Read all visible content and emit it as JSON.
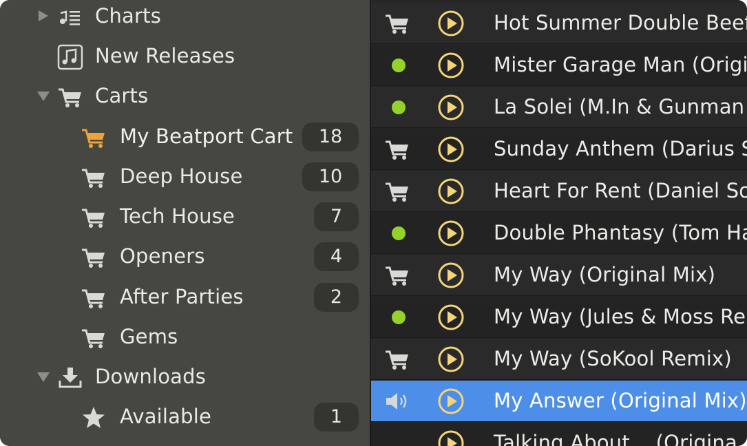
{
  "sidebar": {
    "items": [
      {
        "label": "Charts",
        "icon": "music-list-icon",
        "expander": "collapsed",
        "level": 0
      },
      {
        "label": "New Releases",
        "icon": "music-note-icon",
        "expander": "none",
        "level": 0
      },
      {
        "label": "Carts",
        "icon": "cart-icon",
        "expander": "expanded",
        "level": 0
      },
      {
        "label": "My Beatport Cart",
        "icon": "cart-icon",
        "badge": "18",
        "level": 1,
        "highlight": true
      },
      {
        "label": "Deep House",
        "icon": "cart-icon",
        "badge": "10",
        "level": 1
      },
      {
        "label": "Tech House",
        "icon": "cart-icon",
        "badge": "7",
        "level": 1
      },
      {
        "label": "Openers",
        "icon": "cart-icon",
        "badge": "4",
        "level": 1
      },
      {
        "label": "After Parties",
        "icon": "cart-icon",
        "badge": "2",
        "level": 1
      },
      {
        "label": "Gems",
        "icon": "cart-icon",
        "level": 1
      },
      {
        "label": "Downloads",
        "icon": "download-icon",
        "expander": "expanded",
        "level": 0
      },
      {
        "label": "Available",
        "icon": "star-icon",
        "badge": "1",
        "level": 1
      }
    ]
  },
  "tracks": [
    {
      "title": "Hot Summer Double Beef",
      "status": "cart"
    },
    {
      "title": "Mister Garage Man (Origi",
      "status": "dot"
    },
    {
      "title": "La Solei (M.In & Gunman",
      "status": "dot"
    },
    {
      "title": "Sunday Anthem (Darius S",
      "status": "cart"
    },
    {
      "title": "Heart For Rent (Daniel So",
      "status": "cart"
    },
    {
      "title": "Double Phantasy (Tom Ha",
      "status": "dot"
    },
    {
      "title": "My Way (Original Mix)",
      "status": "cart"
    },
    {
      "title": "My Way (Jules & Moss Ren",
      "status": "dot"
    },
    {
      "title": "My Way (SoKool Remix)",
      "status": "cart"
    },
    {
      "title": "My Answer (Original Mix)",
      "status": "speaker",
      "selected": true
    },
    {
      "title": "Talking About... (Origina",
      "status": "none"
    }
  ],
  "colors": {
    "accent_selection": "#4d8ee8",
    "cart_highlight": "#f0a33a",
    "downloaded_dot": "#95d12b",
    "play_icon": "#f5d57a"
  }
}
